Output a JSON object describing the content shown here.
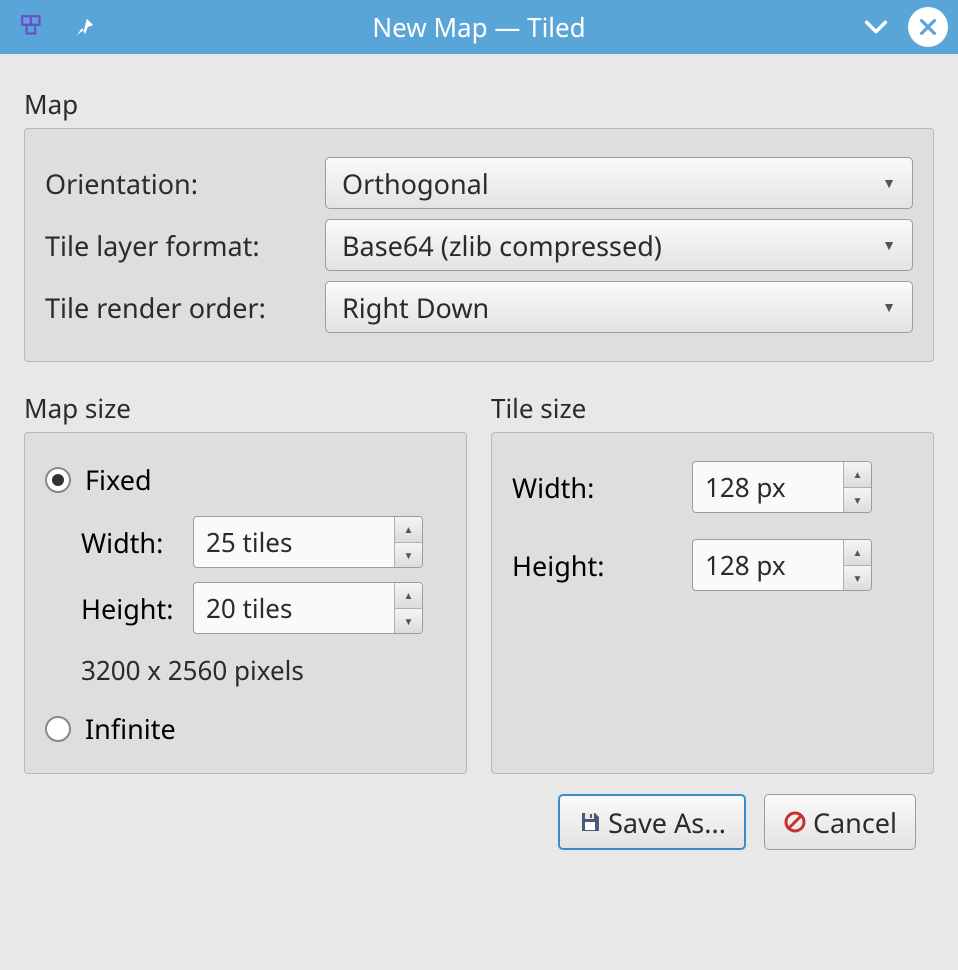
{
  "window": {
    "title": "New Map — Tiled"
  },
  "map": {
    "group_label": "Map",
    "orientation_label": "Orientation:",
    "orientation_value": "Orthogonal",
    "layer_format_label": "Tile layer format:",
    "layer_format_value": "Base64 (zlib compressed)",
    "render_order_label": "Tile render order:",
    "render_order_value": "Right Down"
  },
  "map_size": {
    "group_label": "Map size",
    "fixed_label": "Fixed",
    "width_label": "Width:",
    "width_value": "25 tiles",
    "height_label": "Height:",
    "height_value": "20 tiles",
    "pixel_summary": "3200 x 2560 pixels",
    "infinite_label": "Infinite"
  },
  "tile_size": {
    "group_label": "Tile size",
    "width_label": "Width:",
    "width_value": "128 px",
    "height_label": "Height:",
    "height_value": "128 px"
  },
  "buttons": {
    "save_as": "Save As...",
    "cancel": "Cancel"
  }
}
